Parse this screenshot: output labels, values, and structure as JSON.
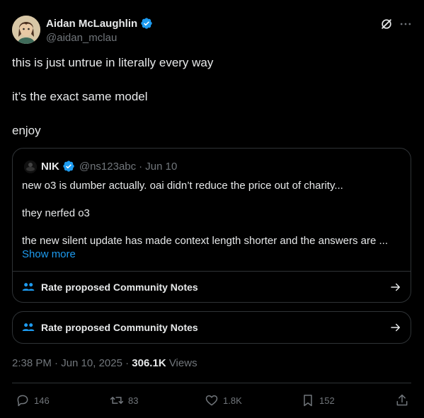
{
  "author": {
    "name": "Aidan McLaughlin",
    "handle": "@aidan_mclau"
  },
  "post": {
    "line1": "this is just untrue in literally every way",
    "line2": "it’s the exact same model",
    "line3": "enjoy"
  },
  "quote": {
    "name": "NIK",
    "handle": "@ns123abc",
    "date": "· Jun 10",
    "line1": "new o3 is dumber actually. oai didn’t reduce the price out of charity...",
    "line2": "they nerfed o3",
    "line3": "the new silent update has made context length shorter and the answers are ...",
    "show_more": "Show more",
    "community_notes": "Rate proposed Community Notes"
  },
  "community_notes": {
    "label": "Rate proposed Community Notes"
  },
  "meta": {
    "time": "2:38 PM · Jun 10, 2025 ·",
    "views_count": "306.1K",
    "views_label": "Views"
  },
  "actions": {
    "replies": "146",
    "reposts": "83",
    "likes": "1.8K",
    "bookmarks": "152"
  },
  "colors": {
    "background": "#000000",
    "text": "#e7e9ea",
    "muted": "#71767b",
    "accent": "#1d9bf0",
    "border": "#2f3336"
  }
}
